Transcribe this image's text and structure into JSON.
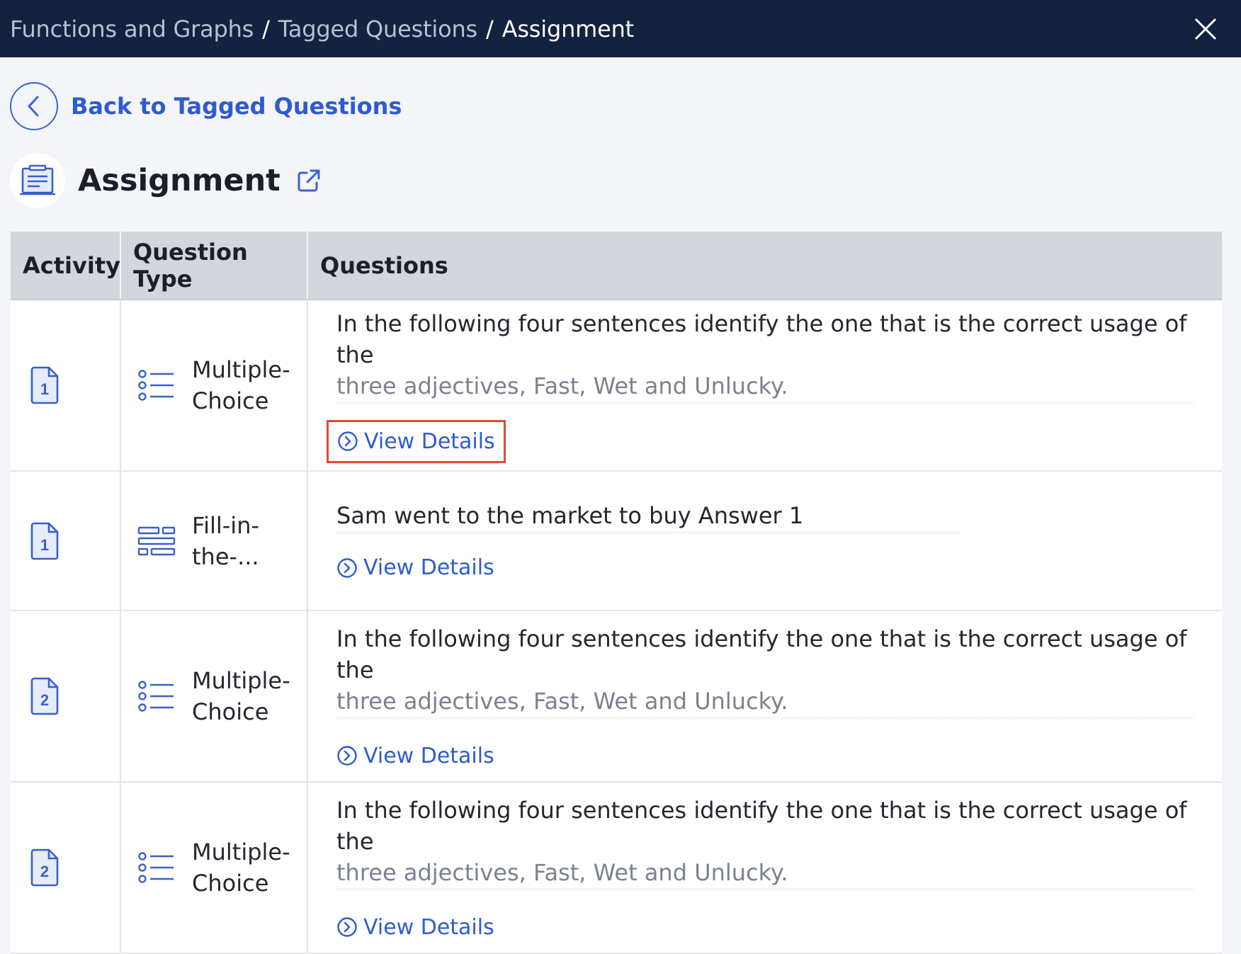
{
  "breadcrumb": {
    "items": [
      "Functions and Graphs",
      "Tagged Questions"
    ],
    "separator": "/",
    "current": "Assignment"
  },
  "back_link": {
    "label": "Back to Tagged Questions"
  },
  "page": {
    "title": "Assignment"
  },
  "table": {
    "headers": {
      "activity": "Activity",
      "type": "Question Type",
      "questions": "Questions"
    },
    "rows": [
      {
        "activity_number": "1",
        "type_label": "Multiple-Choice",
        "type_label_line1": "Multiple-",
        "type_label_line2": "Choice",
        "type_icon": "list-icon",
        "question_line1": "In the following four sentences identify the one that is the correct usage of the",
        "question_line2": "three adjectives, Fast, Wet and Unlucky.",
        "view_details": "View Details"
      },
      {
        "activity_number": "1",
        "type_label": "Fill-in-the-...",
        "type_label_line1": "Fill-in-",
        "type_label_line2": "the-...",
        "type_icon": "fill-blank-icon",
        "question_line1": "Sam went to the market to buy Answer 1",
        "question_line2": "",
        "view_details": "View Details"
      },
      {
        "activity_number": "2",
        "type_label": "Multiple-Choice",
        "type_label_line1": "Multiple-",
        "type_label_line2": "Choice",
        "type_icon": "list-icon",
        "question_line1": "In the following four sentences identify the one that is the correct usage of the",
        "question_line2": "three adjectives, Fast, Wet and Unlucky.",
        "view_details": "View Details"
      },
      {
        "activity_number": "2",
        "type_label": "Multiple-Choice",
        "type_label_line1": "Multiple-",
        "type_label_line2": "Choice",
        "type_icon": "list-icon",
        "question_line1": "In the following four sentences identify the one that is the correct usage of the",
        "question_line2": "three adjectives, Fast, Wet and Unlucky.",
        "view_details": "View Details"
      }
    ]
  },
  "colors": {
    "topbar": "#13223f",
    "accent": "#2f5bd0",
    "highlight_border": "#e04a33",
    "header_bg": "#d3d6dc"
  }
}
